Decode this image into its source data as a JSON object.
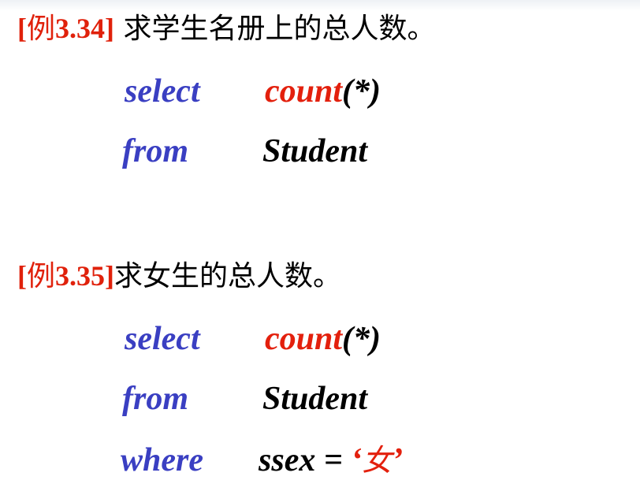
{
  "example1": {
    "label_bracket_open": "[",
    "label_cjk": "例",
    "label_num": "3.34",
    "label_bracket_close": "]",
    "title": " 求学生名册上的总人数。",
    "line1": {
      "keyword": "select",
      "func": "count",
      "args": "(*)"
    },
    "line2": {
      "keyword": "from",
      "table": "Student"
    }
  },
  "example2": {
    "label_bracket_open": "[",
    "label_cjk": "例",
    "label_num": "3.35",
    "label_bracket_close": "]",
    "title": "求女生的总人数。",
    "line1": {
      "keyword": "select",
      "func": "count",
      "args": "(*)"
    },
    "line2": {
      "keyword": "from",
      "table": "Student"
    },
    "line3": {
      "keyword": "where",
      "condition": "ssex = ",
      "quote_open": "‘",
      "value": "女",
      "quote_close": "’"
    }
  },
  "colors": {
    "keyword": "#3a3fc2",
    "function": "#e3200d",
    "label": "#e0210b",
    "text": "#000000"
  }
}
